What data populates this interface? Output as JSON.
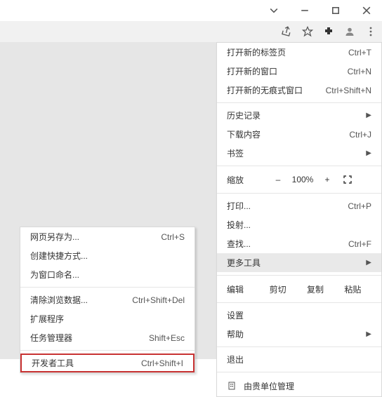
{
  "main_menu": {
    "new_tab": {
      "label": "打开新的标签页",
      "shortcut": "Ctrl+T"
    },
    "new_window": {
      "label": "打开新的窗口",
      "shortcut": "Ctrl+N"
    },
    "incognito": {
      "label": "打开新的无痕式窗口",
      "shortcut": "Ctrl+Shift+N"
    },
    "history": {
      "label": "历史记录"
    },
    "downloads": {
      "label": "下载内容",
      "shortcut": "Ctrl+J"
    },
    "bookmarks": {
      "label": "书签"
    },
    "zoom": {
      "label": "缩放",
      "minus": "–",
      "pct": "100%",
      "plus": "+"
    },
    "print": {
      "label": "打印...",
      "shortcut": "Ctrl+P"
    },
    "cast": {
      "label": "投射..."
    },
    "find": {
      "label": "查找...",
      "shortcut": "Ctrl+F"
    },
    "more_tools": {
      "label": "更多工具"
    },
    "edit": {
      "label": "编辑",
      "cut": "剪切",
      "copy": "复制",
      "paste": "粘贴"
    },
    "settings": {
      "label": "设置"
    },
    "help": {
      "label": "帮助"
    },
    "exit": {
      "label": "退出"
    },
    "managed": {
      "label": "由贵单位管理"
    }
  },
  "sub_menu": {
    "save_as": {
      "label": "网页另存为...",
      "shortcut": "Ctrl+S"
    },
    "create_shortcut": {
      "label": "创建快捷方式..."
    },
    "name_window": {
      "label": "为窗口命名..."
    },
    "clear_data": {
      "label": "清除浏览数据...",
      "shortcut": "Ctrl+Shift+Del"
    },
    "extensions": {
      "label": "扩展程序"
    },
    "task_manager": {
      "label": "任务管理器",
      "shortcut": "Shift+Esc"
    },
    "devtools": {
      "label": "开发者工具",
      "shortcut": "Ctrl+Shift+I"
    }
  }
}
